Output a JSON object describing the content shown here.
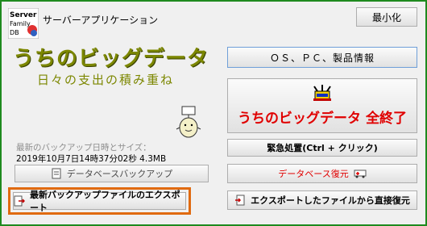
{
  "app": {
    "logo_text_line1": "Server",
    "logo_text_line2": "Family",
    "logo_text_line3": "DB",
    "title": "サーバーアプリケーション",
    "minimize_label": "最小化",
    "big_title": "うちのビッグデータ",
    "subtitle": "日々の支出の積み重ね"
  },
  "right": {
    "info_label": "ＯＳ、ＰＣ、製品情報",
    "end_label": "うちのビッグデータ 全終了",
    "emergency_label": "緊急処置(Ctrl + クリック)",
    "db_restore_label": "データベース復元",
    "export_restore_label": "エクスポートしたファイルから直接復元"
  },
  "left": {
    "backup_caption": "最新のバックアップ日時とサイズ：",
    "backup_value": "2019年10月7日14時37分02秒 4.3MB",
    "db_backup_label": "データベースバックアップ",
    "export_label": "最新バックアップファイルのエクスポート"
  },
  "colors": {
    "title_olive": "#7c8700",
    "end_red": "#e00000",
    "export_highlight": "#e06a10",
    "window_border": "#1f8a1f"
  }
}
